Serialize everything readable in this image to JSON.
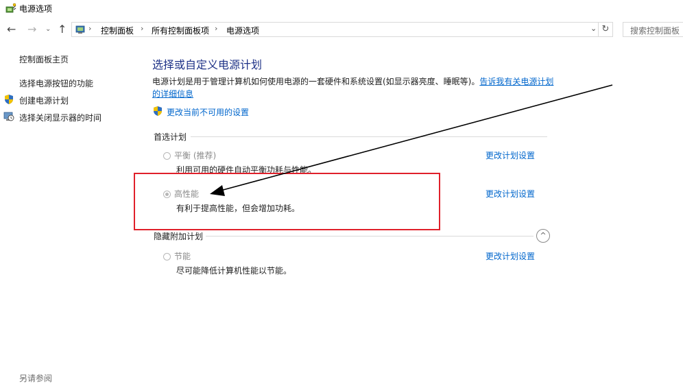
{
  "window": {
    "title": "电源选项"
  },
  "nav": {
    "back": "←",
    "forward": "→",
    "recent": "⌄",
    "up": "↑",
    "breadcrumbs": [
      "控制面板",
      "所有控制面板项",
      "电源选项"
    ],
    "separator": "›",
    "dropdown": "⌄",
    "refresh": "↻",
    "search_placeholder": "搜索控制面板"
  },
  "sidebar": {
    "home": "控制面板主页",
    "items": [
      {
        "label": "选择电源按钮的功能"
      },
      {
        "label": "创建电源计划",
        "icon": "uac-shield-icon"
      },
      {
        "label": "选择关闭显示器的时间",
        "icon": "display-clock-icon"
      }
    ],
    "see_also": "另请参阅"
  },
  "main": {
    "heading": "选择或自定义电源计划",
    "intro_text": "电源计划是用于管理计算机如何使用电源的一套硬件和系统设置(如显示器亮度、睡眠等)。",
    "intro_link": "告诉我有关电源计划的详细信息",
    "change_unavailable": "更改当前不可用的设置",
    "preferred_section": "首选计划",
    "hidden_section": "隐藏附加计划",
    "plans": [
      {
        "name": "平衡 (推荐)",
        "desc": "利用可用的硬件自动平衡功耗与性能。",
        "link": "更改计划设置",
        "selected": false
      },
      {
        "name": "高性能",
        "desc": "有利于提高性能，但会增加功耗。",
        "link": "更改计划设置",
        "selected": true
      },
      {
        "name": "节能",
        "desc": "尽可能降低计算机性能以节能。",
        "link": "更改计划设置",
        "selected": false
      }
    ],
    "collapse_glyph": "^"
  },
  "colors": {
    "heading": "#1e3287",
    "link": "#0066cc",
    "highlight": "#e0202a"
  }
}
